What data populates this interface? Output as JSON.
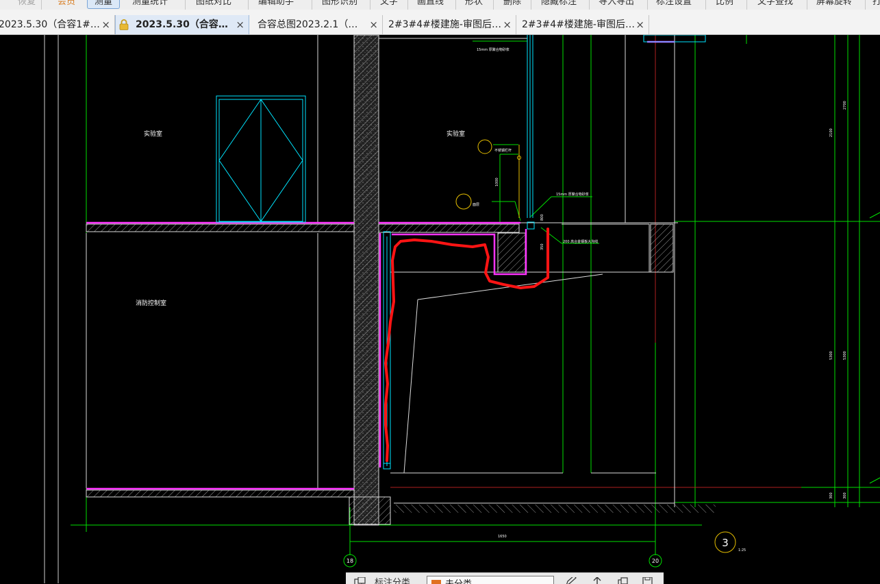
{
  "menubar": {
    "items": [
      "恢复",
      "会员",
      "测量",
      "测量统计",
      "图纸对比",
      "编辑助手",
      "图形识别",
      "文字",
      "画直线",
      "形状",
      "删除",
      "隐藏标注",
      "导入导出",
      "标注设置",
      "比例",
      "文字查找",
      "屏幕旋转",
      "打"
    ]
  },
  "tabs": [
    {
      "label": "2023.5.30（合容1#…",
      "close": "×"
    },
    {
      "label": "2023.5.30（合容…",
      "close": "×"
    },
    {
      "label": "合容总图2023.2.1（…",
      "close": "×"
    },
    {
      "label": "2#3#4#楼建施-审图后…",
      "close": "×"
    },
    {
      "label": "2#3#4#楼建施-审图后…",
      "close": "×"
    }
  ],
  "drawing": {
    "room_labels": [
      "实验室",
      "实验室",
      "消防控制室"
    ],
    "gridline_labels": [
      "18",
      "20"
    ],
    "dimension_text": "1650",
    "detail_marker": {
      "number": "3",
      "scale": "1:25"
    },
    "annotations": [
      "15mm 厚聚合物砂浆",
      "15mm 厚聚合物砂浆",
      "不锈钢栏杆",
      "200 高合金钢板大沟线",
      "面层",
      "1000",
      "800",
      "350",
      "300",
      "2700",
      "2100",
      "2100",
      "300",
      "300",
      "300",
      "5300",
      "5300"
    ]
  },
  "bottombar": {
    "label": "标注分类",
    "selected": "未分类"
  },
  "colors": {
    "background": "#000000",
    "wall": "#ffffff",
    "magenta": "#ff33ff",
    "cyan": "#00e5ff",
    "green": "#00ff00",
    "red_markup": "#ff1414",
    "dark_red_line": "#aa2222"
  }
}
